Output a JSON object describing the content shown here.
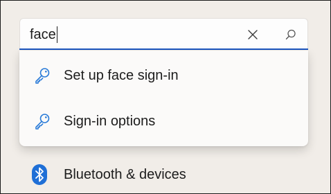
{
  "search": {
    "value": "face",
    "clear_icon": "close-icon",
    "search_icon": "search-icon"
  },
  "suggestions": [
    {
      "label": "Set up face sign-in",
      "icon": "key-icon"
    },
    {
      "label": "Sign-in options",
      "icon": "key-icon"
    }
  ],
  "nav": {
    "bluetooth_label": "Bluetooth & devices",
    "bluetooth_icon": "bluetooth-icon"
  },
  "colors": {
    "accent": "#1b55c0",
    "bluetooth_blue": "#1f6fd6",
    "key_blue": "#2a7bd8"
  }
}
